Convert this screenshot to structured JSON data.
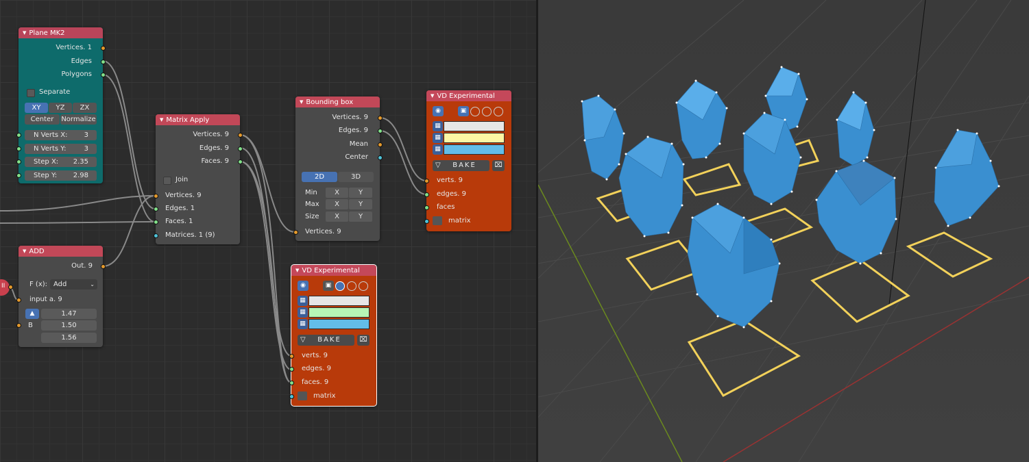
{
  "nodes": {
    "plane": {
      "title": "Plane MK2",
      "outputs": [
        "Vertices. 1",
        "Edges",
        "Polygons"
      ],
      "separate_label": "Separate",
      "axis_buttons": [
        "XY",
        "YZ",
        "ZX"
      ],
      "center_label": "Center",
      "normalize_label": "Normalize",
      "params": [
        {
          "label": "N Verts X:",
          "value": "3"
        },
        {
          "label": "N Verts Y:",
          "value": "3"
        },
        {
          "label": "Step X:",
          "value": "2.35"
        },
        {
          "label": "Step Y:",
          "value": "2.98"
        }
      ]
    },
    "add": {
      "title": "ADD",
      "output": "Out. 9",
      "func_label": "F (x):",
      "func_value": "Add",
      "input_a": "input a. 9",
      "b_label": "B",
      "b_values": [
        "1.47",
        "1.50",
        "1.56"
      ]
    },
    "matrix_apply": {
      "title": "Matrix Apply",
      "outputs": [
        "Vertices. 9",
        "Edges. 9",
        "Faces. 9"
      ],
      "join_label": "Join",
      "inputs": [
        "Vertices. 9",
        "Edges. 1",
        "Faces. 1",
        "Matrices. 1 (9)"
      ]
    },
    "bbox": {
      "title": "Bounding box",
      "outputs": [
        "Vertices. 9",
        "Edges. 9",
        "Mean",
        "Center"
      ],
      "dim_buttons": [
        "2D",
        "3D"
      ],
      "grid_rows": [
        {
          "label": "Min",
          "cells": [
            "X",
            "Y"
          ]
        },
        {
          "label": "Max",
          "cells": [
            "X",
            "Y"
          ]
        },
        {
          "label": "Size",
          "cells": [
            "X",
            "Y"
          ]
        }
      ],
      "input": "Vertices. 9"
    },
    "vd1": {
      "title": "VD Experimental",
      "bake_label": "BAKE",
      "inputs": [
        "verts. 9",
        "edges. 9",
        "faces",
        "matrix"
      ],
      "swatch_colors": [
        "#e6e6e6",
        "#fdf6a4",
        "#63bde8"
      ]
    },
    "vd2": {
      "title": "VD Experimental",
      "bake_label": "BAKE",
      "inputs": [
        "verts. 9",
        "edges. 9",
        "faces. 9",
        "matrix"
      ],
      "swatch_colors": [
        "#e6e6e6",
        "#b6f5b6",
        "#63bde8"
      ]
    }
  },
  "colors": {
    "node_header": "#c24858",
    "plane_body": "#0e6b6b",
    "vd_body": "#b83a0a",
    "active_button": "#4772b3",
    "mesh_blue": "#3a8fd0",
    "edge_yellow": "#f2d15a"
  },
  "viewport": {
    "object_count": 9,
    "description_icon": "3d-viewport"
  }
}
